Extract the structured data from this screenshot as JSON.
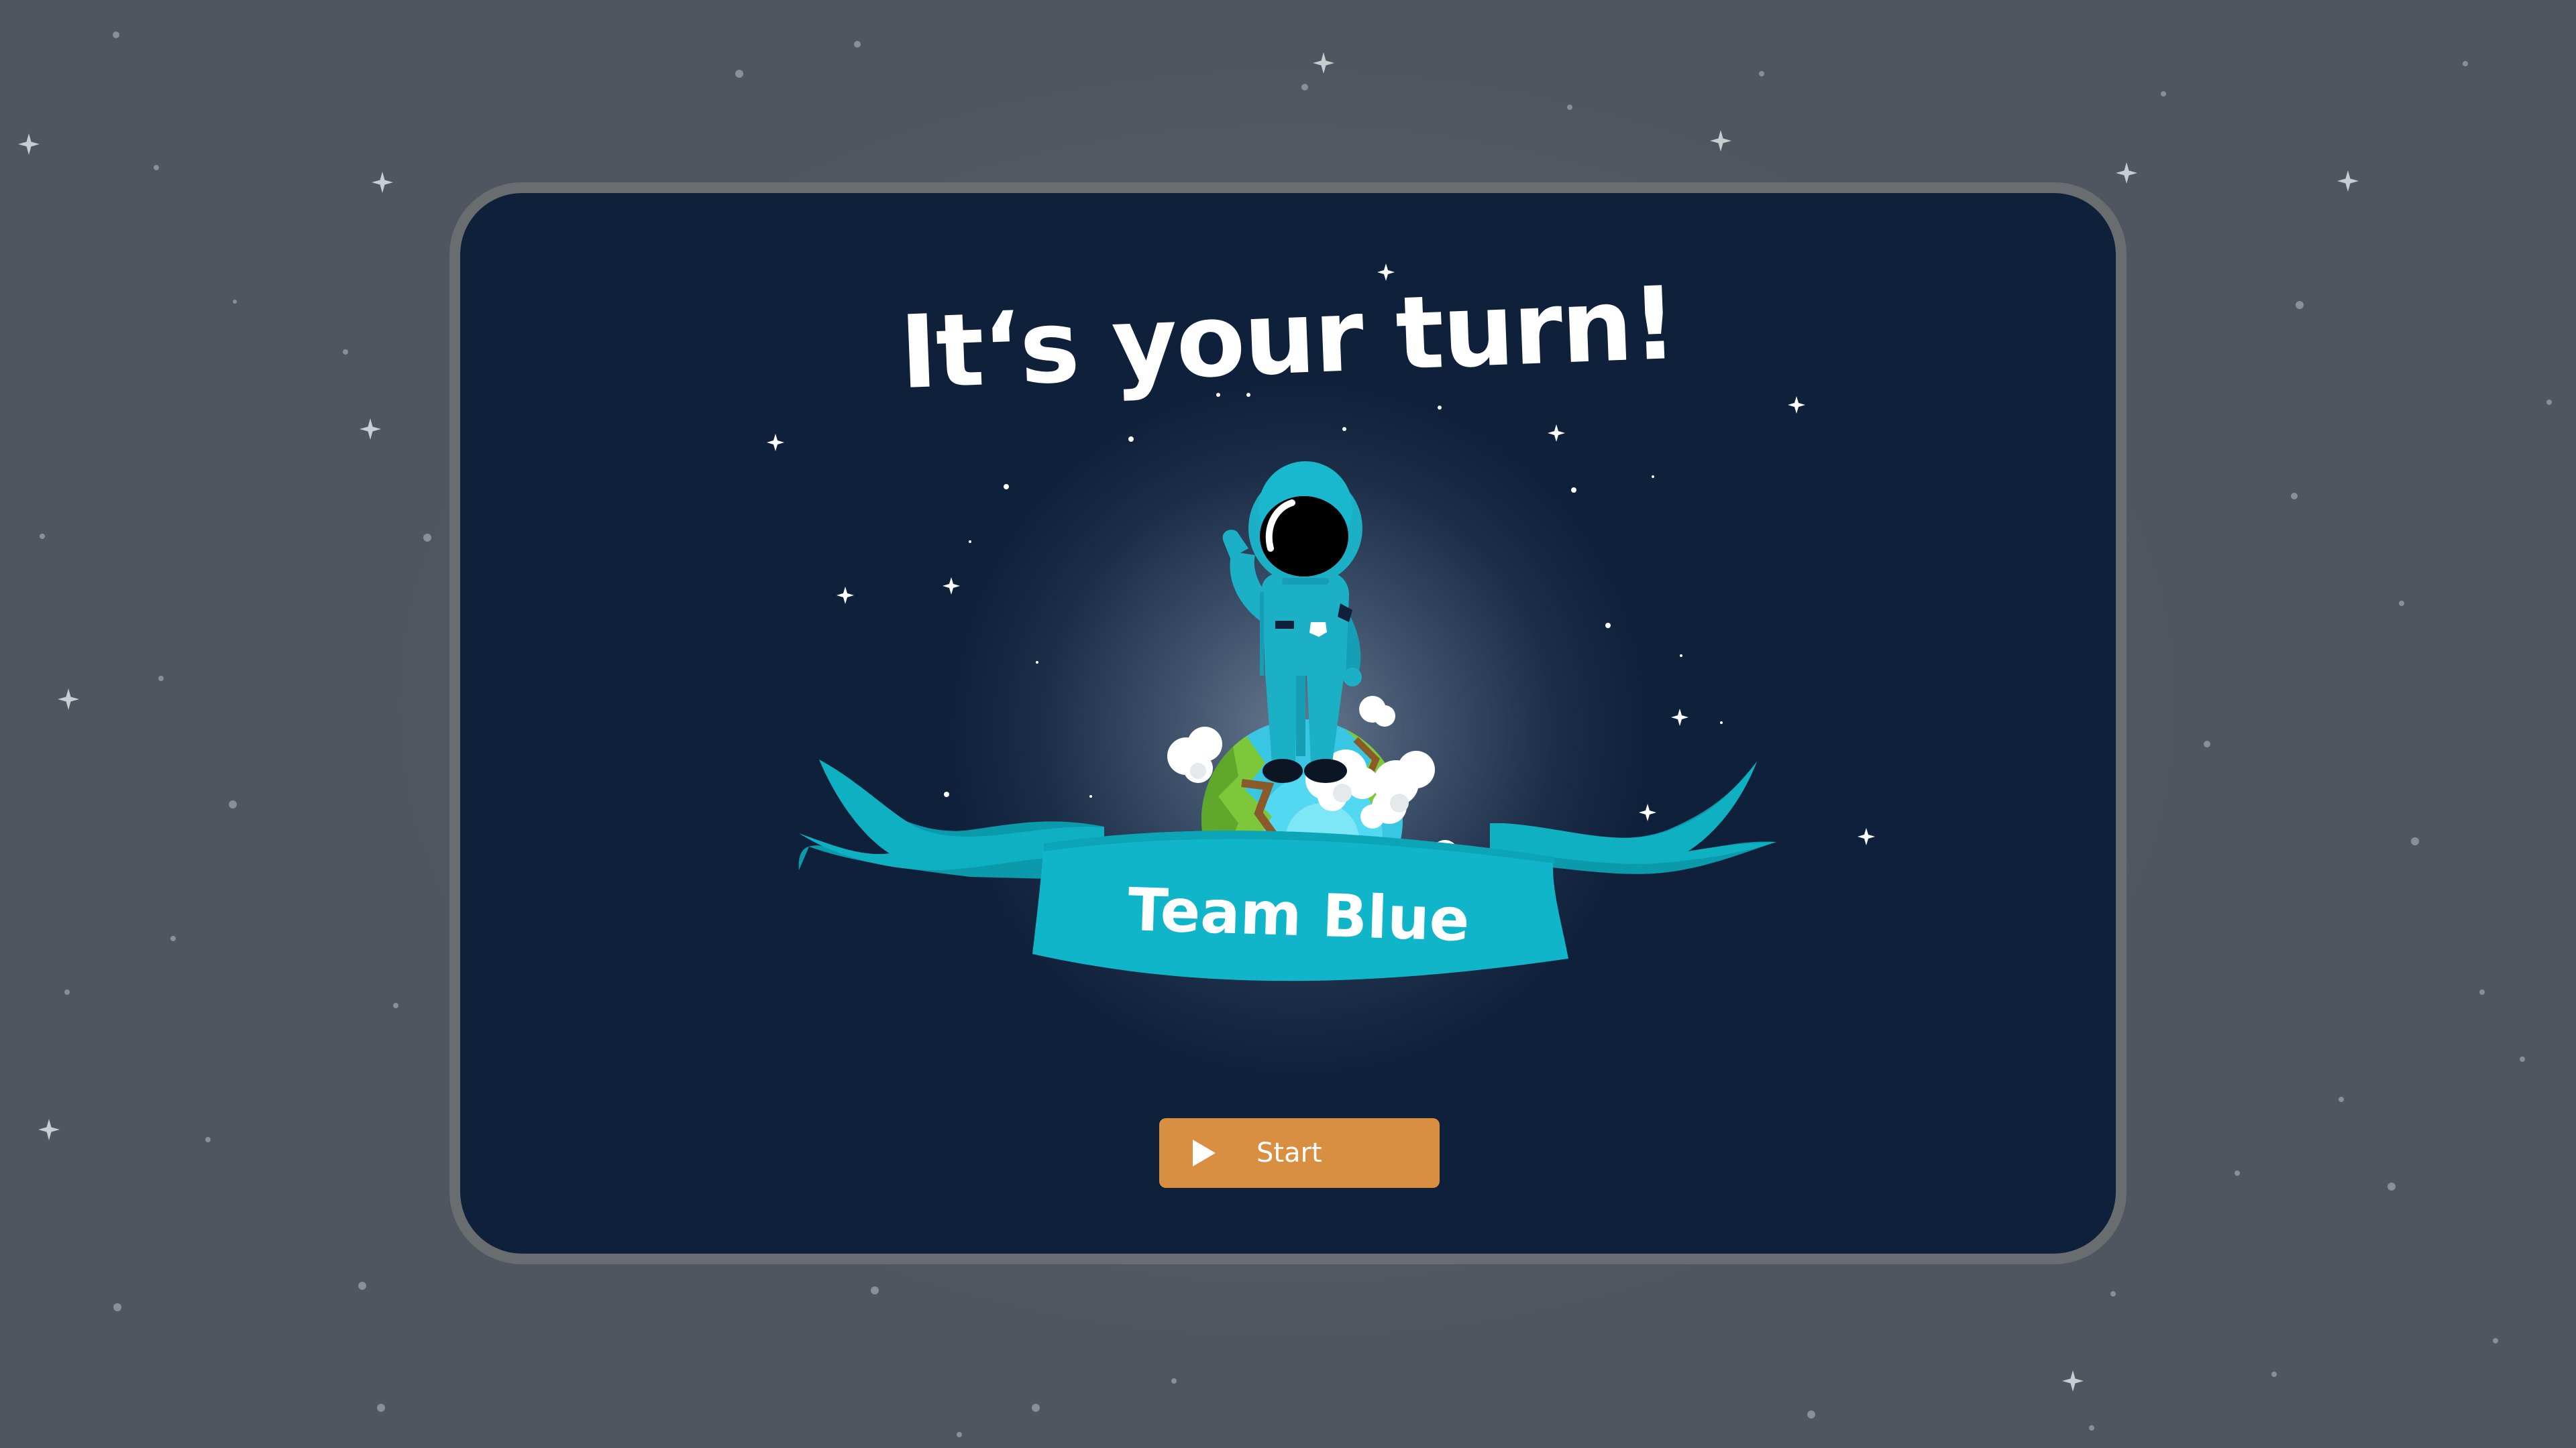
{
  "screen": {
    "title": "It‘s your turn!",
    "team_name": "Team Blue",
    "start_button": {
      "label": "Start",
      "icon": "play-icon"
    }
  },
  "colors": {
    "page_background": "#545a63",
    "card_background": "#0f203a",
    "card_border": "#6a6d70",
    "banner": "#10b5c9",
    "banner_dark": "#0a9aab",
    "astronaut_suit": "#1cb0c6",
    "start_button": "#d98f42",
    "text": "#ffffff"
  },
  "icons": {
    "hero": "astronaut-on-planet",
    "play": "play-icon",
    "stars": "sparkle-star-icon"
  }
}
